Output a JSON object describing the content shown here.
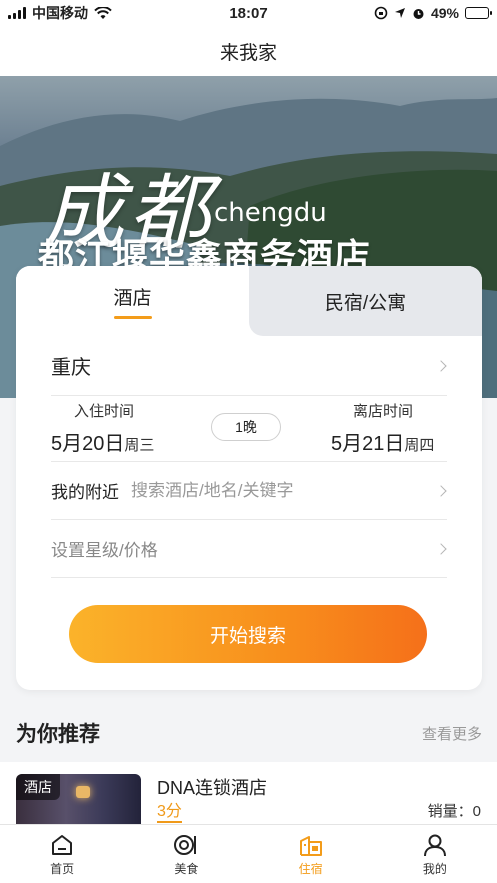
{
  "status_bar": {
    "carrier": "中国移动",
    "time": "18:07",
    "battery": "49%",
    "battery_level": 0.49
  },
  "nav": {
    "title": "来我家"
  },
  "banner": {
    "city_cn": "成都",
    "city_en": "chengdu",
    "hotel_name": "都江堰华鑫商务酒店"
  },
  "search": {
    "tabs": [
      {
        "label": "酒店",
        "active": true
      },
      {
        "label": "民宿/公寓",
        "active": false
      }
    ],
    "city": "重庆",
    "checkin_label": "入住时间",
    "checkin_date": "5月20日",
    "checkin_weekday": "周三",
    "nights": "1晚",
    "checkout_label": "离店时间",
    "checkout_date": "5月21日",
    "checkout_weekday": "周四",
    "nearby_label": "我的附近",
    "keyword_placeholder": "搜索酒店/地名/关键字",
    "star_price_label": "设置星级/价格",
    "button_label": "开始搜索"
  },
  "recommend": {
    "title": "为你推荐",
    "more": "查看更多",
    "items": [
      {
        "tag": "酒店",
        "name": "DNA连锁酒店",
        "score": "3分",
        "sales": "销量：0"
      }
    ]
  },
  "tabbar": {
    "items": [
      {
        "label": "首页",
        "icon": "home-icon",
        "active": false
      },
      {
        "label": "美食",
        "icon": "food-icon",
        "active": false
      },
      {
        "label": "住宿",
        "icon": "hotel-icon",
        "active": true
      },
      {
        "label": "我的",
        "icon": "profile-icon",
        "active": false
      }
    ],
    "active_color": "#f39c1a"
  }
}
